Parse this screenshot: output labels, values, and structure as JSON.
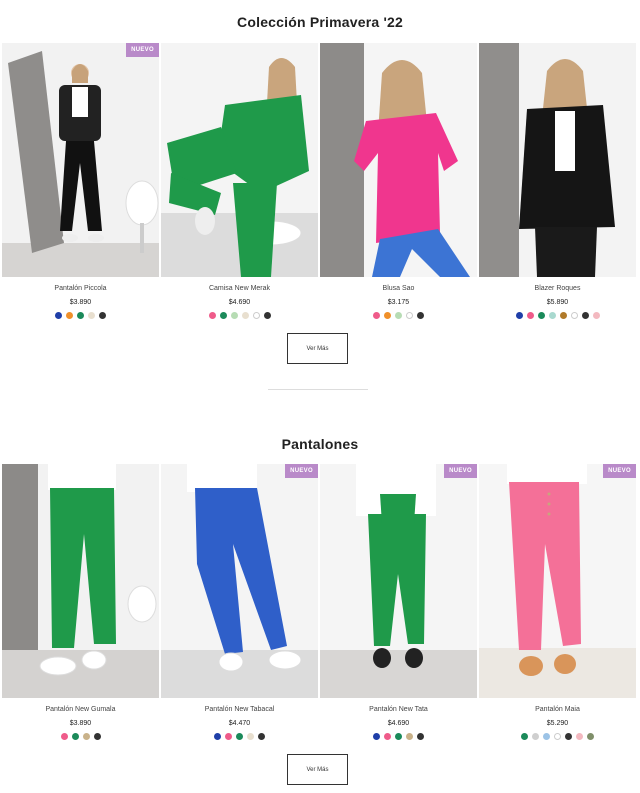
{
  "sections": [
    {
      "title": "Colección Primavera '22",
      "more_label": "Ver Más",
      "products": [
        {
          "name": "Pantalón Piccola",
          "price": "$3.890",
          "badge": "NUEVO",
          "swatches": [
            "#1f3fa8",
            "#f0902a",
            "#1b8a5a",
            "#e8dfcf",
            "#333333"
          ]
        },
        {
          "name": "Camisa New Merak",
          "price": "$4.690",
          "badge": "",
          "swatches": [
            "#ef5b8a",
            "#1b8a5a",
            "#b7dcb4",
            "#e8dfcf",
            "#ffffff",
            "#333333"
          ]
        },
        {
          "name": "Blusa Sao",
          "price": "$3.175",
          "badge": "",
          "swatches": [
            "#ef5b8a",
            "#f0902a",
            "#b7dcb4",
            "#ffffff",
            "#333333"
          ]
        },
        {
          "name": "Blazer Roques",
          "price": "$5.890",
          "badge": "",
          "swatches": [
            "#1f3fa8",
            "#ef5b8a",
            "#1b8a5a",
            "#a9d9cf",
            "#b07a2a",
            "#ffffff",
            "#333333",
            "#f3b9c0"
          ]
        }
      ]
    },
    {
      "title": "Pantalones",
      "more_label": "Ver Más",
      "products": [
        {
          "name": "Pantalón New Gumala",
          "price": "$3.890",
          "badge": "",
          "swatches": [
            "#ef5b8a",
            "#1b8a5a",
            "#c9b28a",
            "#333333"
          ]
        },
        {
          "name": "Pantalón New Tabacal",
          "price": "$4.470",
          "badge": "NUEVO",
          "swatches": [
            "#1f3fa8",
            "#ef5b8a",
            "#1b8a5a",
            "#e8dfcf",
            "#333333"
          ]
        },
        {
          "name": "Pantalón New Tata",
          "price": "$4.690",
          "badge": "NUEVO",
          "swatches": [
            "#1f3fa8",
            "#ef5b8a",
            "#1b8a5a",
            "#c9b28a",
            "#333333"
          ]
        },
        {
          "name": "Pantalón Maia",
          "price": "$5.290",
          "badge": "NUEVO",
          "swatches": [
            "#1b8a5a",
            "#cfcfcf",
            "#9cc3e6",
            "#ffffff",
            "#333333",
            "#f3b9c0",
            "#7f8f6a"
          ]
        }
      ]
    }
  ],
  "colors": {
    "badge": "#b98ac9"
  }
}
